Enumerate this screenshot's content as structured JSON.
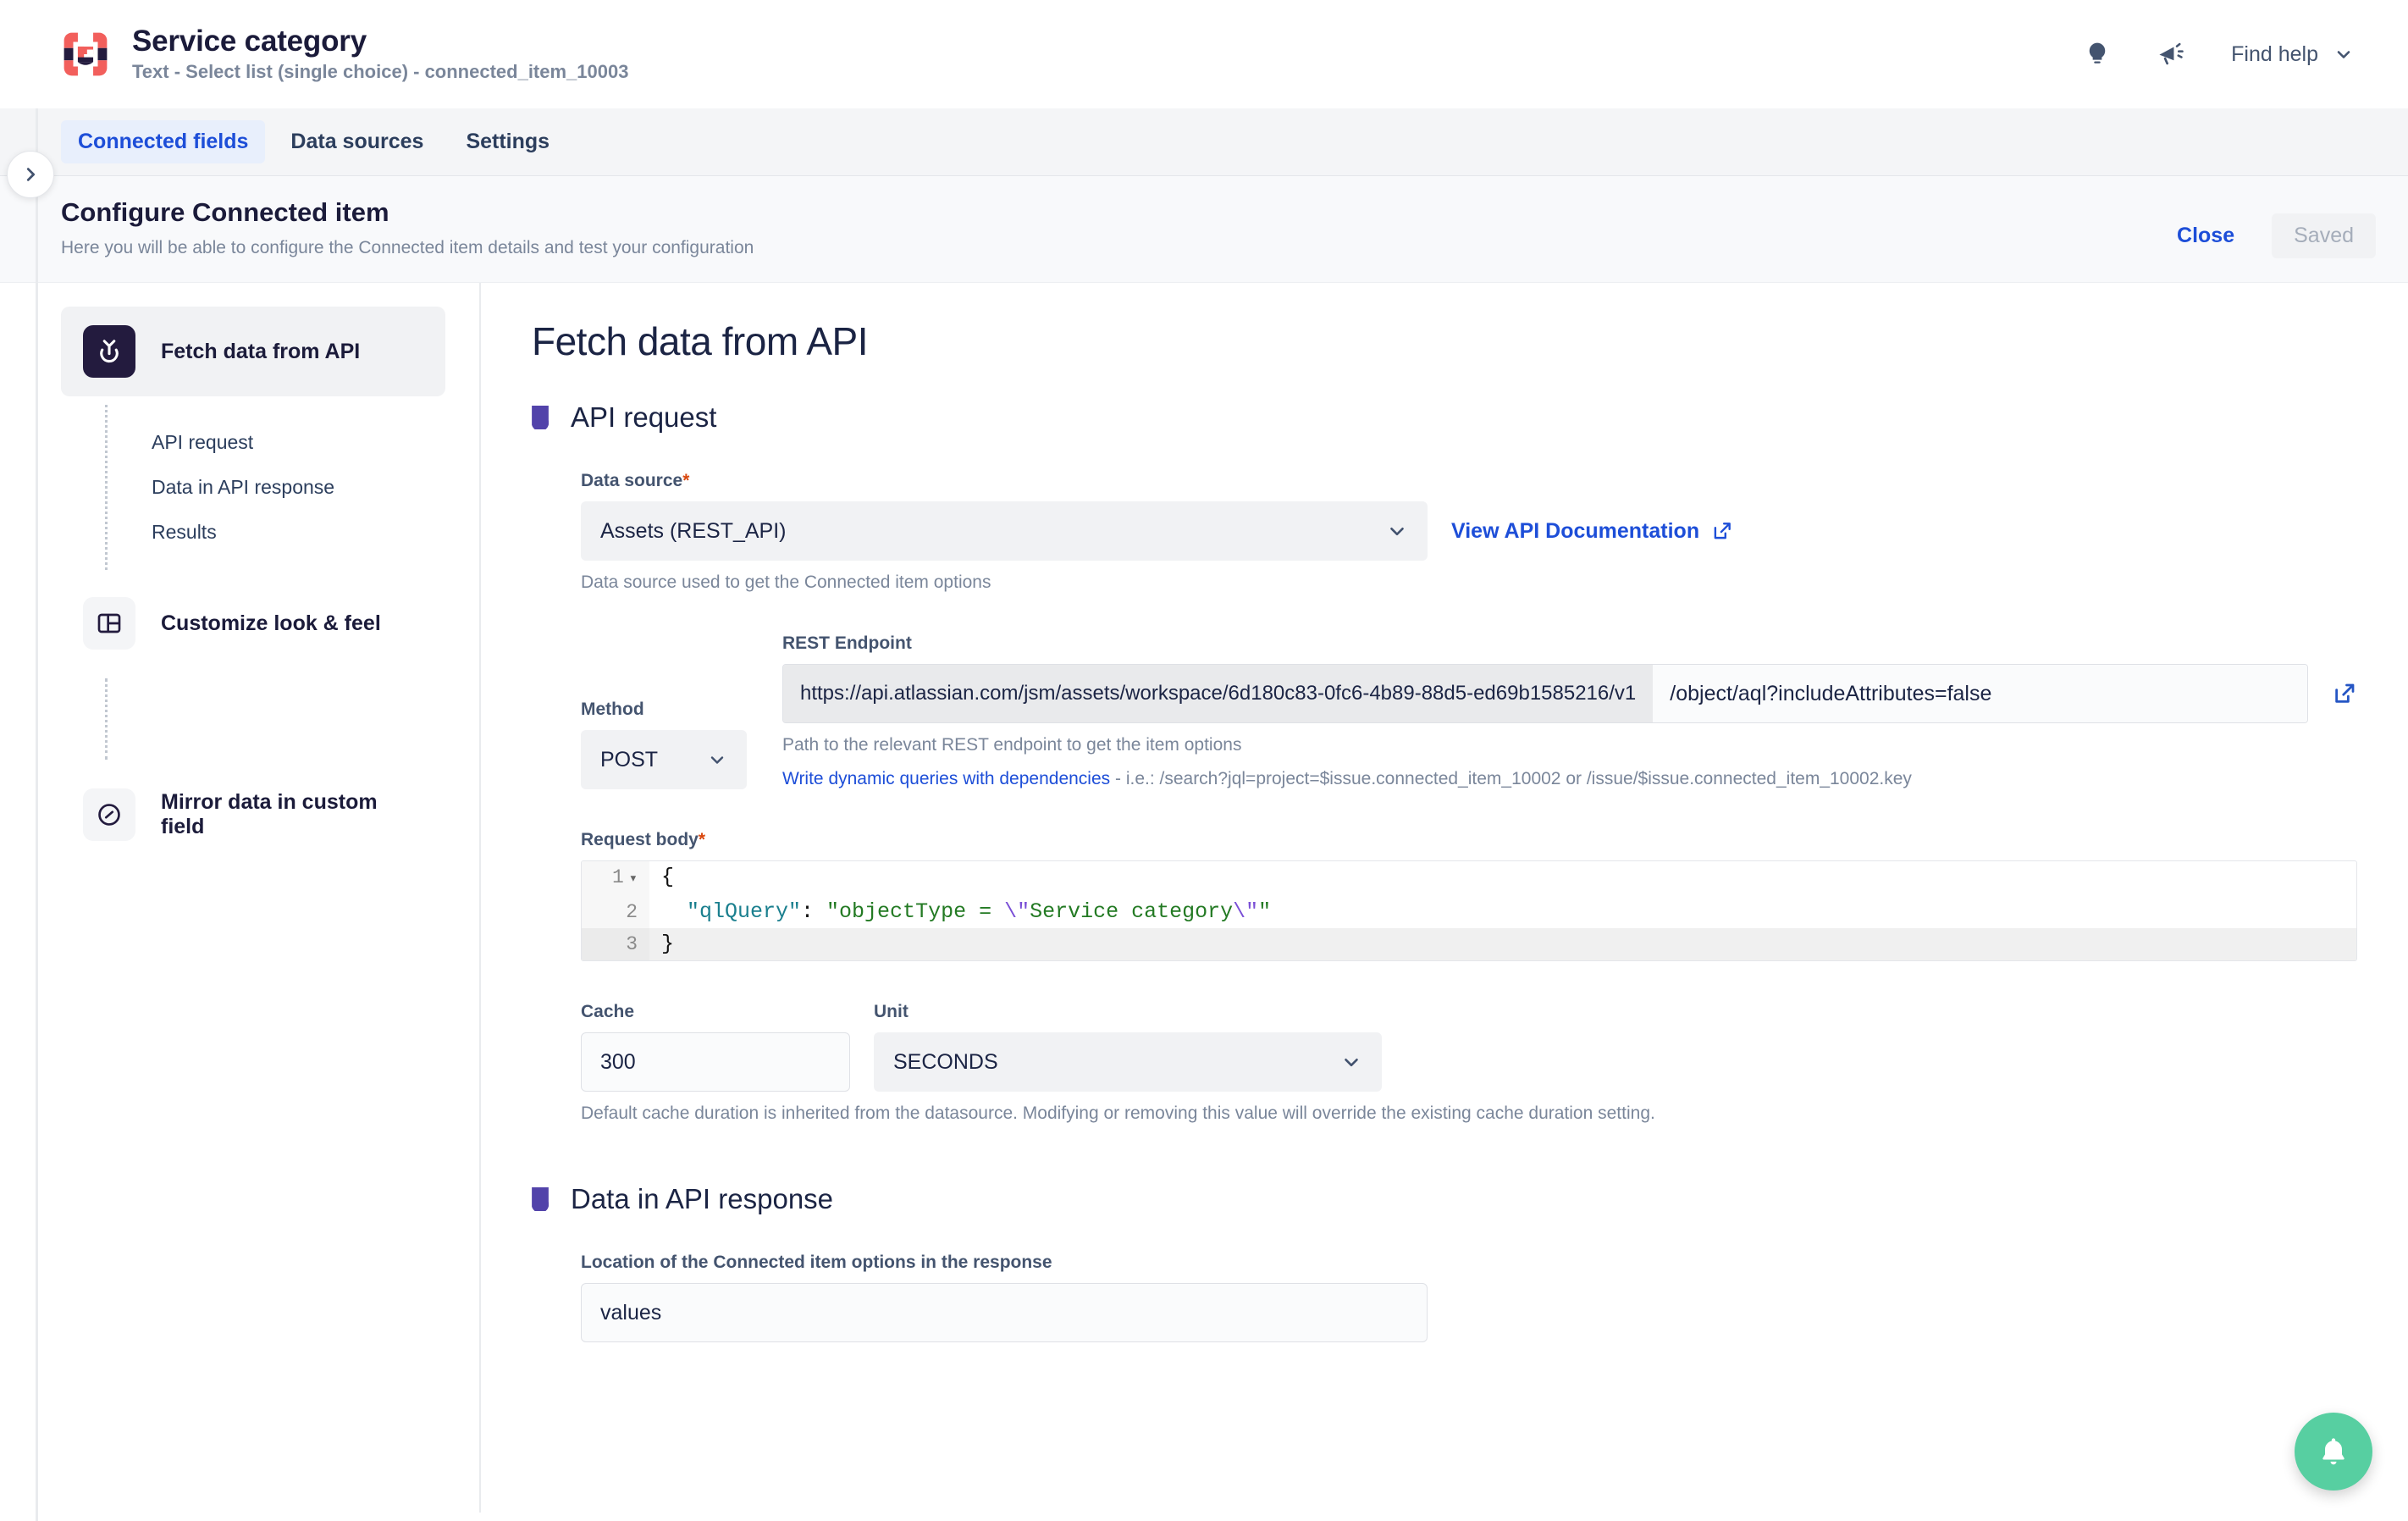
{
  "app": {
    "field_name": "Service category",
    "field_meta": "Text - Select list (single choice) - connected_item_10003",
    "logo_icon": "connected-fields-logo-icon",
    "accent_blue": "#1D4ED8",
    "accent_purple": "#5243AA",
    "brand_red": "#F25F5C",
    "brand_dark": "#231B3E"
  },
  "topbar": {
    "tips_icon": "lightbulb-icon",
    "announcements_icon": "megaphone-icon",
    "find_help_label": "Find help",
    "find_help_chevron": "chevron-down-icon"
  },
  "tabs": [
    {
      "label": "Connected fields",
      "active": true
    },
    {
      "label": "Data sources",
      "active": false
    },
    {
      "label": "Settings",
      "active": false
    }
  ],
  "configure": {
    "title": "Configure Connected item",
    "subtitle": "Here you will be able to configure the Connected item details and test your configuration",
    "close_label": "Close",
    "saved_label": "Saved"
  },
  "sidebar": {
    "collapse_icon": "chevron-right-icon",
    "steps": [
      {
        "label": "Fetch data from API",
        "icon": "fetch-api-icon",
        "active": true,
        "sub_items": [
          "API request",
          "Data in API response",
          "Results"
        ]
      },
      {
        "label": "Customize look & feel",
        "icon": "layout-panel-icon",
        "active": false
      },
      {
        "label": "Mirror data in custom field",
        "icon": "mirror-circle-icon",
        "active": false
      }
    ]
  },
  "main": {
    "title": "Fetch data from API",
    "sections": [
      {
        "title": "API request"
      },
      {
        "title": "Data in API response"
      }
    ],
    "data_source": {
      "label": "Data source",
      "required": true,
      "value": "Assets (REST_API)",
      "chevron": "chevron-down-icon",
      "hint": "Data source used to get the Connected item options",
      "doc_link": "View API Documentation",
      "doc_link_icon": "external-link-icon"
    },
    "method": {
      "label": "Method",
      "value": "POST",
      "chevron": "chevron-down-icon"
    },
    "endpoint": {
      "label": "REST Endpoint",
      "base_url": "https://api.atlassian.com/jsm/assets/workspace/6d180c83-0fc6-4b89-88d5-ed69b1585216/v1",
      "path_value": "/object/aql?includeAttributes=false",
      "open_icon": "external-link-icon",
      "hint": "Path to the relevant REST endpoint to get the item options",
      "dynamic_link": "Write dynamic queries with dependencies",
      "dynamic_example": " - i.e.: /search?jql=project=$issue.connected_item_10002 or /issue/$issue.connected_item_10002.key"
    },
    "request_body": {
      "label": "Request body",
      "required": true,
      "lines": [
        {
          "num": "1",
          "foldable": true,
          "highlighted": false,
          "tokens": [
            {
              "t": "pun",
              "v": "{"
            }
          ]
        },
        {
          "num": "2",
          "foldable": false,
          "highlighted": false,
          "tokens": [
            {
              "t": "plain",
              "v": "  "
            },
            {
              "t": "key",
              "v": "\"qlQuery\""
            },
            {
              "t": "pun",
              "v": ": "
            },
            {
              "t": "str",
              "v": "\"objectType = "
            },
            {
              "t": "esc",
              "v": "\\\""
            },
            {
              "t": "str",
              "v": "Service category"
            },
            {
              "t": "esc",
              "v": "\\\""
            },
            {
              "t": "str",
              "v": "\""
            }
          ]
        },
        {
          "num": "3",
          "foldable": false,
          "highlighted": true,
          "tokens": [
            {
              "t": "pun",
              "v": "}"
            }
          ]
        }
      ]
    },
    "cache": {
      "label": "Cache",
      "value": "300",
      "unit_label": "Unit",
      "unit_value": "SECONDS",
      "unit_chevron": "chevron-down-icon",
      "hint": "Default cache duration is inherited from the datasource. Modifying or removing this value will override the existing cache duration setting."
    },
    "response_location": {
      "label": "Location of the Connected item options in the response",
      "value": "values"
    }
  },
  "fab": {
    "icon": "bell-icon",
    "color": "#57CFA1"
  }
}
